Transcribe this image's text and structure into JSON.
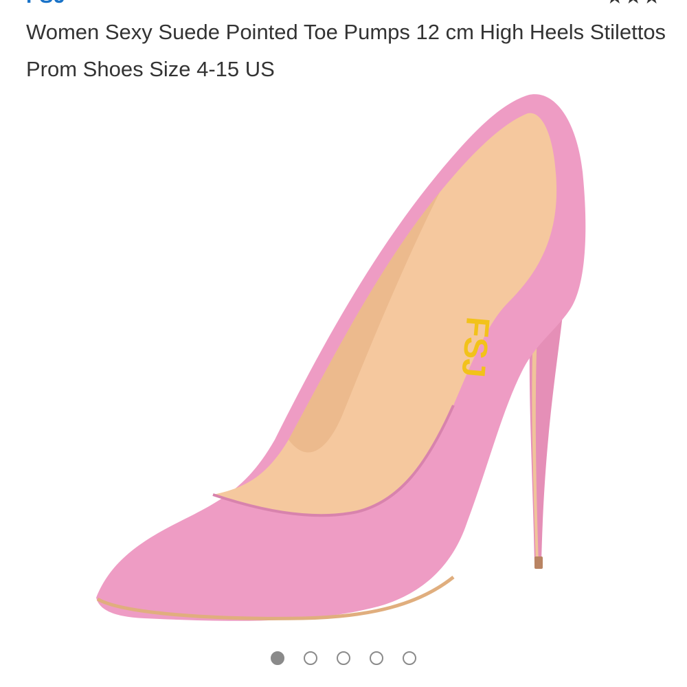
{
  "product": {
    "title": "Women Sexy Suede Pointed Toe Pumps 12 cm High Heels Stilettos Prom Shoes Size 4-15 US",
    "image_icon": "pink-suede-pump-image",
    "logo_text": "FSJ"
  },
  "colors": {
    "suede": "#ee9cc4",
    "lining": "#f5c89e",
    "logo": "#f2c21a",
    "dot": "#8a8a8a"
  },
  "gallery": {
    "image_count": 5,
    "active_index": 0
  }
}
